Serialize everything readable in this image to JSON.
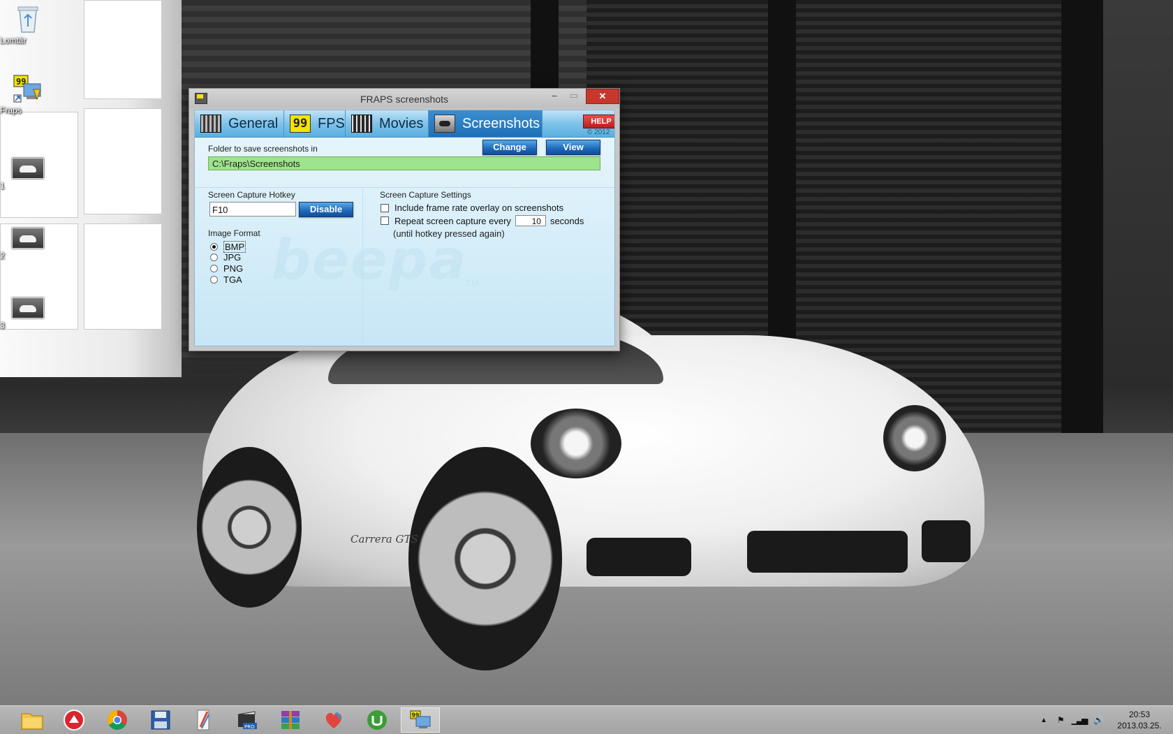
{
  "desktop": {
    "icons": [
      {
        "label": "Lomtár",
        "icon": "recycle-bin-icon"
      },
      {
        "label": "Fraps",
        "icon": "fraps-shortcut-icon"
      },
      {
        "label": "1",
        "icon": "image-file-icon"
      },
      {
        "label": "2",
        "icon": "image-file-icon"
      },
      {
        "label": "3",
        "icon": "image-file-icon"
      }
    ],
    "car_badge": "Carrera GTS"
  },
  "window": {
    "title": "FRAPS screenshots",
    "controls": {
      "minimize": "‒",
      "maximize": "▭",
      "close": "✕"
    },
    "tabs": [
      {
        "label": "General",
        "icon": "general-tab-icon",
        "active": false
      },
      {
        "label": "FPS",
        "icon": "fps-tab-icon",
        "active": false,
        "icon_text": "99"
      },
      {
        "label": "Movies",
        "icon": "movies-tab-icon",
        "active": false
      },
      {
        "label": "Screenshots",
        "icon": "screenshots-tab-icon",
        "active": true
      }
    ],
    "help_label": "HELP",
    "copyright": "© 2012",
    "folder": {
      "label": "Folder to save screenshots in",
      "value": "C:\\Fraps\\Screenshots",
      "change_label": "Change",
      "view_label": "View"
    },
    "hotkey": {
      "label": "Screen Capture Hotkey",
      "value": "F10",
      "disable_label": "Disable"
    },
    "image_format": {
      "label": "Image Format",
      "options": [
        "BMP",
        "JPG",
        "PNG",
        "TGA"
      ],
      "selected": "BMP"
    },
    "settings": {
      "label": "Screen Capture Settings",
      "overlay_label": "Include frame rate overlay on screenshots",
      "overlay_checked": false,
      "repeat_label": "Repeat screen capture every",
      "repeat_value": "10",
      "repeat_unit": "seconds",
      "repeat_note": "(until hotkey pressed again)",
      "repeat_checked": false
    },
    "watermark": "beepa",
    "watermark_tm": "TM"
  },
  "taskbar": {
    "apps": [
      {
        "icon": "file-explorer-icon",
        "active": false
      },
      {
        "icon": "antivirus-icon",
        "active": false
      },
      {
        "icon": "chrome-icon",
        "active": false
      },
      {
        "icon": "floppy-save-icon",
        "active": false
      },
      {
        "icon": "paint-brush-icon",
        "active": false
      },
      {
        "icon": "video-pro-icon",
        "active": false
      },
      {
        "icon": "winrar-icon",
        "active": false
      },
      {
        "icon": "heart-app-icon",
        "active": false
      },
      {
        "icon": "utorrent-icon",
        "active": false
      },
      {
        "icon": "fraps-taskbar-icon",
        "active": true
      }
    ],
    "tray_icons": [
      "tray-arrow-icon",
      "flag-icon",
      "network-icon",
      "volume-icon"
    ],
    "time": "20:53",
    "date": "2013.03.25."
  },
  "colors": {
    "tab_active": "#1f6fb5",
    "folder_field": "#9ee38d",
    "close_button": "#c7372d",
    "help_button": "#b71f1f"
  }
}
